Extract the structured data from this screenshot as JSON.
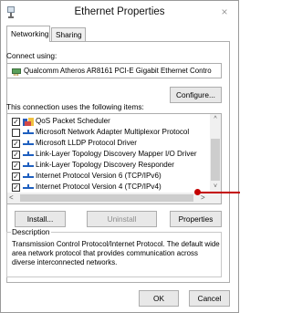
{
  "window": {
    "title": "Ethernet Properties",
    "close_glyph": "×"
  },
  "tabs": [
    {
      "label": "Networking"
    },
    {
      "label": "Sharing"
    }
  ],
  "connect_using": {
    "label": "Connect using:",
    "adapter": "Qualcomm Atheros AR8161 PCI-E Gigabit Ethernet Contro",
    "configure_button": "Configure..."
  },
  "items_section": {
    "label": "This connection uses the following items:",
    "items": [
      {
        "label": "QoS Packet Scheduler",
        "checked": true,
        "icon": "qos-icon"
      },
      {
        "label": "Microsoft Network Adapter Multiplexor Protocol",
        "checked": false,
        "icon": "protocol-icon"
      },
      {
        "label": "Microsoft LLDP Protocol Driver",
        "checked": true,
        "icon": "protocol-icon"
      },
      {
        "label": "Link-Layer Topology Discovery Mapper I/O Driver",
        "checked": true,
        "icon": "protocol-icon"
      },
      {
        "label": "Link-Layer Topology Discovery Responder",
        "checked": true,
        "icon": "protocol-icon"
      },
      {
        "label": "Internet Protocol Version 6 (TCP/IPv6)",
        "checked": true,
        "icon": "protocol-icon"
      },
      {
        "label": "Internet Protocol Version 4 (TCP/IPv4)",
        "checked": true,
        "icon": "protocol-icon"
      }
    ],
    "buttons": {
      "install": "Install...",
      "uninstall": "Uninstall",
      "properties": "Properties"
    }
  },
  "description": {
    "label": "Description",
    "text": "Transmission Control Protocol/Internet Protocol. The default wide area network protocol that provides communication across diverse interconnected networks."
  },
  "footer": {
    "ok": "OK",
    "cancel": "Cancel"
  },
  "scroll_glyphs": {
    "up": "^",
    "down": "˅",
    "left": "<",
    "right": ">"
  },
  "colors": {
    "annotation": "#c40000",
    "accent_blue": "#1e5fbf"
  }
}
